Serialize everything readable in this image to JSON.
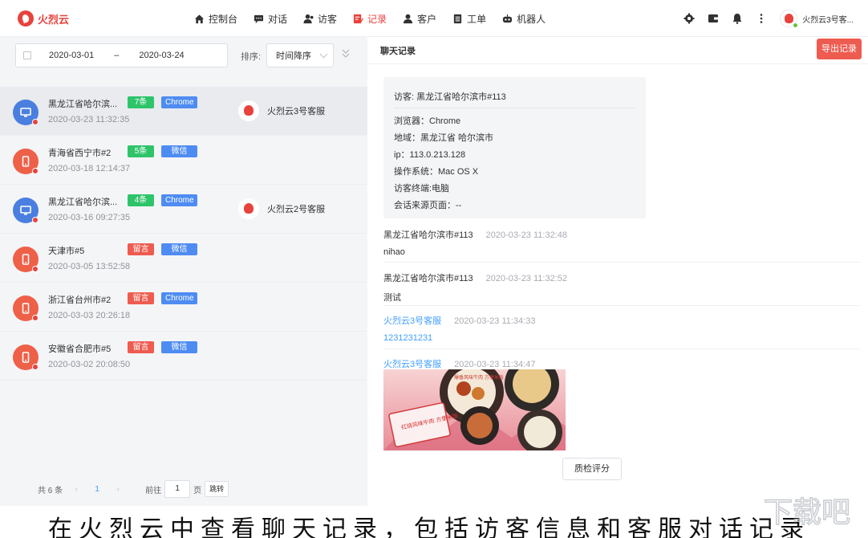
{
  "app": {
    "brand": "火烈云"
  },
  "nav": [
    {
      "label": "控制台",
      "icon": "home-icon"
    },
    {
      "label": "对话",
      "icon": "chat-icon"
    },
    {
      "label": "访客",
      "icon": "visitor-icon"
    },
    {
      "label": "记录",
      "icon": "record-icon",
      "active": true
    },
    {
      "label": "客户",
      "icon": "customer-icon"
    },
    {
      "label": "工单",
      "icon": "ticket-icon"
    },
    {
      "label": "机器人",
      "icon": "robot-icon"
    }
  ],
  "user": {
    "name": "火烈云3号客..."
  },
  "filter": {
    "start_date": "2020-03-01",
    "separator": "–",
    "end_date": "2020-03-24",
    "sort_label": "排序:",
    "sort_value": "时间降序"
  },
  "sessions": [
    {
      "name": "黑龙江省哈尔滨...",
      "time": "2020-03-23 11:32:35",
      "device": "pc",
      "tag1": "7条",
      "tag1_color": "green",
      "tag2": "Chrome",
      "agent": "火烈云3号客服"
    },
    {
      "name": "青海省西宁市#2",
      "time": "2020-03-18 12:14:37",
      "device": "mobile",
      "tag1": "5条",
      "tag1_color": "green",
      "tag2": "微信",
      "agent": ""
    },
    {
      "name": "黑龙江省哈尔滨...",
      "time": "2020-03-16 09:27:35",
      "device": "pc",
      "tag1": "4条",
      "tag1_color": "green",
      "tag2": "Chrome",
      "agent": "火烈云2号客服"
    },
    {
      "name": "天津市#5",
      "time": "2020-03-05 13:52:58",
      "device": "mobile",
      "tag1": "留言",
      "tag1_color": "red",
      "tag2": "微信",
      "agent": ""
    },
    {
      "name": "浙江省台州市#2",
      "time": "2020-03-03 20:26:18",
      "device": "mobile",
      "tag1": "留言",
      "tag1_color": "red",
      "tag2": "Chrome",
      "agent": ""
    },
    {
      "name": "安徽省合肥市#5",
      "time": "2020-03-02 20:08:50",
      "device": "mobile",
      "tag1": "留言",
      "tag1_color": "red",
      "tag2": "微信",
      "agent": ""
    }
  ],
  "pager": {
    "total": "共 6 条",
    "prev": "‹",
    "current": "1",
    "next": "›",
    "goto_label": "前往",
    "goto_value": "1",
    "unit": "页",
    "jump": "跳转"
  },
  "chat": {
    "title": "聊天记录",
    "export": "导出记录",
    "visitor_title": "访客: 黑龙江省哈尔滨市#113",
    "info": [
      "浏览器：Chrome",
      "地域：黑龙江省 哈尔滨市",
      "ip：113.0.213.128",
      "操作系统：Mac OS X",
      "访客终端:电脑",
      "会话来源页面：--"
    ],
    "messages": [
      {
        "sender": "黑龙江省哈尔滨市#113",
        "time": "2020-03-23 11:32:48",
        "text": "nihao",
        "from_agent": false
      },
      {
        "sender": "黑龙江省哈尔滨市#113",
        "time": "2020-03-23 11:32:52",
        "text": "测试",
        "from_agent": false
      },
      {
        "sender": "火烈云3号客服",
        "time": "2020-03-23 11:34:33",
        "text": "1231231231",
        "from_agent": true
      },
      {
        "sender": "火烈云3号客服",
        "time": "2020-03-23 11:34:47",
        "text": "",
        "from_agent": true
      }
    ],
    "image_text_top": "爆香风味牛肉 方便米饭",
    "image_text_bottom": "红烧风味牛肉 方便米饭",
    "qc_button": "质检评分"
  },
  "caption": "在火烈云中查看聊天记录，包括访客信息和客服对话记录",
  "colors": {
    "brand": "#e8423c",
    "link": "#409eff",
    "tag_green": "#2ec46a",
    "tag_blue": "#4e8cf2",
    "tag_red": "#ee5c50"
  }
}
